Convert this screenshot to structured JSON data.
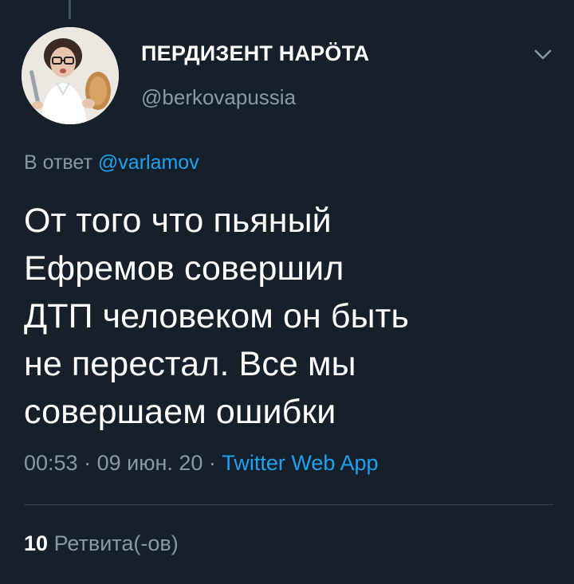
{
  "author": {
    "display_name": "ПЕРДИЗЕНТ НАРÖТА",
    "handle": "@berkovapussia"
  },
  "reply": {
    "prefix": "В ответ",
    "mention": "@varlamov"
  },
  "tweet": {
    "text": "От того что пьяный\nЕфремов совершил\nДТП человеком он быть\nне перестал. Все мы\nсовершаем ошибки"
  },
  "meta": {
    "time": "00:53",
    "separator_1": " · ",
    "date": "09 июн. 20",
    "separator_2": " · ",
    "source": "Twitter Web App"
  },
  "stats": {
    "retweet_count": "10",
    "retweet_label": "Ретвита(-ов)"
  },
  "icons": {
    "menu": "chevron-down-icon",
    "avatar": "avatar"
  },
  "colors": {
    "background": "#15202b",
    "primary_text": "#ffffff",
    "secondary_text": "#8899a6",
    "link": "#1da1f2",
    "divider": "#38444d"
  }
}
